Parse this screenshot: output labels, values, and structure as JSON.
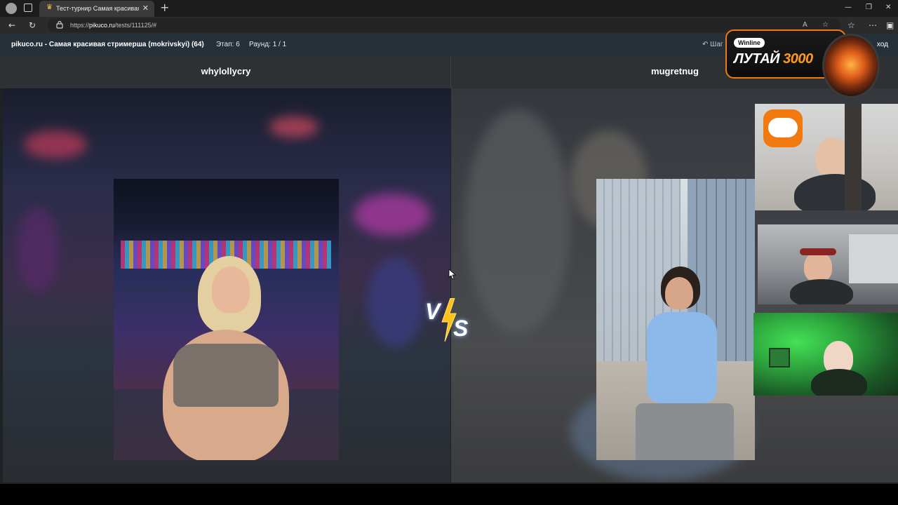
{
  "browser": {
    "tab_title": "Тест-турнир Самая красивая стр",
    "url_prefix": "https://",
    "url_host": "pikuco.ru",
    "url_path": "/tests/111125/#"
  },
  "header": {
    "site_title": "pikuco.ru - Самая красивая стримерша (mokrivskyi) (64)",
    "stage_label": "Этап: 6",
    "round_label": "Раунд: 1 / 1",
    "back_label": "Шаг",
    "exit_label": "ход"
  },
  "left": {
    "name": "whylollycry"
  },
  "right": {
    "name": "mugretnug"
  },
  "versus": {
    "v": "V",
    "s": "S"
  },
  "sponsor": {
    "brand": "Winline",
    "text": "ЛУТАЙ",
    "number": "3000"
  },
  "colors": {
    "accent_orange": "#f07a10",
    "header_bg": "#263039",
    "names_bg": "#2d3134"
  }
}
